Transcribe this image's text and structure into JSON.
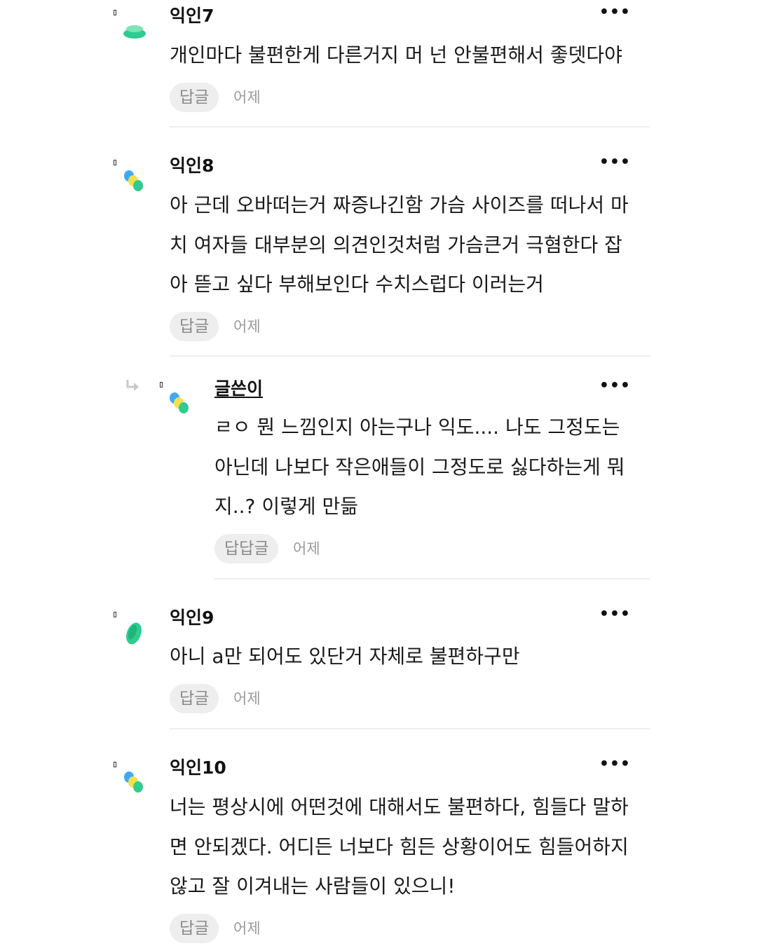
{
  "comments": [
    {
      "author": "익인7",
      "lines": [
        "개인마다 불편한게 다른거지 머 넌 안불편해서 좋뎃다야"
      ],
      "reply_label": "답글",
      "time": "어제",
      "avatar_icon": "green-oval-avatar-icon"
    },
    {
      "author": "익인8",
      "lines": [
        "아 근데 오바떠는거 짜증나긴함 가슴 사이즈를 떠나서 마",
        "치 여자들 대부분의 의견인것처럼 가슴큰거 극혐한다 잡",
        "아 뜯고 싶다 부해보인다 수치스럽다 이러는거"
      ],
      "reply_label": "답글",
      "time": "어제",
      "avatar_icon": "multicolor-dots-avatar-icon"
    },
    {
      "author": "글쓴이",
      "lines": [
        "ㄹㅇ 뭔 느낌인지 아는구나 익도.... 나도 그정도는",
        "아닌데 나보다 작은애들이 그정도로 싫다하는게 뭐",
        "지..? 이렇게 만듦"
      ],
      "reply_label": "답답글",
      "time": "어제",
      "avatar_icon": "multicolor-dots-avatar-icon"
    },
    {
      "author": "익인9",
      "lines": [
        "아니 a만 되어도 있단거 자체로 불편하구만"
      ],
      "reply_label": "답글",
      "time": "어제",
      "avatar_icon": "green-leaf-avatar-icon"
    },
    {
      "author": "익인10",
      "lines": [
        "너는 평상시에 어떤것에 대해서도 불편하다, 힘들다 말하",
        "면 안되겠다. 어디든 너보다 힘든 상황이어도 힘들어하지",
        "않고 잘 이겨내는 사람들이 있으니!"
      ],
      "reply_label": "답글",
      "time": "어제",
      "avatar_icon": "multicolor-dots-avatar-icon"
    }
  ],
  "more_icon": "more-dots-icon",
  "reply_indicator_icon": "reply-arrow-icon",
  "colors": {
    "accent_green": "#2ecc8f",
    "avatar_blue": "#3fa9f5",
    "avatar_yellow": "#f2e14c",
    "reply_bg": "#eeeeee",
    "divider": "#efefef"
  }
}
